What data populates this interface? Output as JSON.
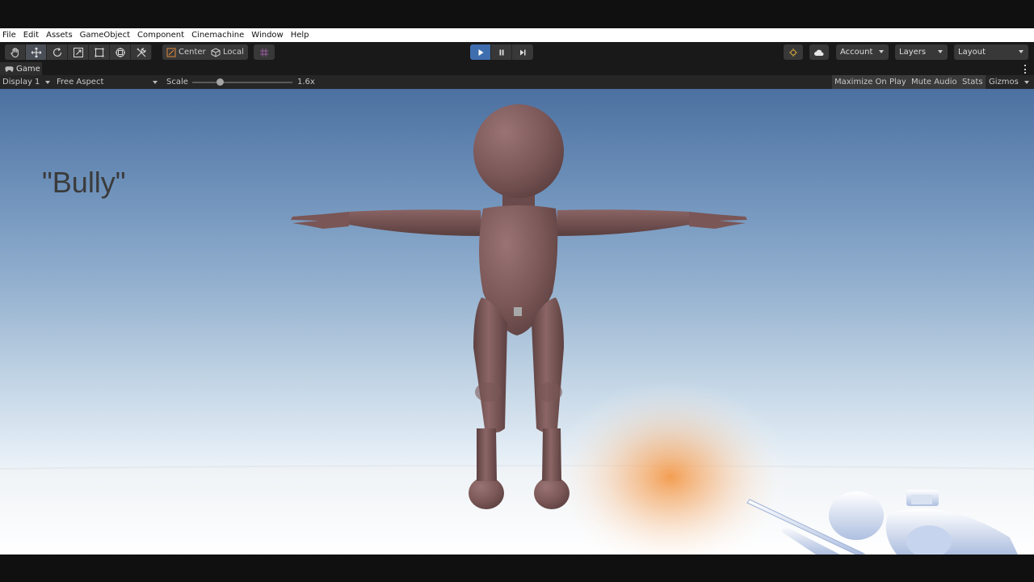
{
  "menu": [
    "File",
    "Edit",
    "Assets",
    "GameObject",
    "Component",
    "Cinemachine",
    "Window",
    "Help"
  ],
  "toolbar": {
    "tools": [
      "hand-tool-icon",
      "move-tool-icon",
      "rotate-tool-icon",
      "scale-tool-icon",
      "rect-tool-icon",
      "transform-tool-icon",
      "custom-tool-icon"
    ],
    "active_tool": "move-tool-icon",
    "pivot_mode": "Center",
    "pivot_rotation": "Local",
    "play_state": "playing",
    "account_label": "Account",
    "layers_label": "Layers",
    "layout_label": "Layout"
  },
  "game_tab": {
    "label": "Game"
  },
  "game_bar": {
    "display": "Display 1",
    "aspect": "Free Aspect",
    "scale_label": "Scale",
    "scale_value": "1.6x",
    "maximize_on_play": "Maximize On Play",
    "mute_audio": "Mute Audio",
    "stats": "Stats",
    "gizmos": "Gizmos"
  },
  "scene": {
    "overlay_text": "\"Bully\"",
    "character_color": "#7a5656",
    "accent_color": "#3f6eae"
  }
}
